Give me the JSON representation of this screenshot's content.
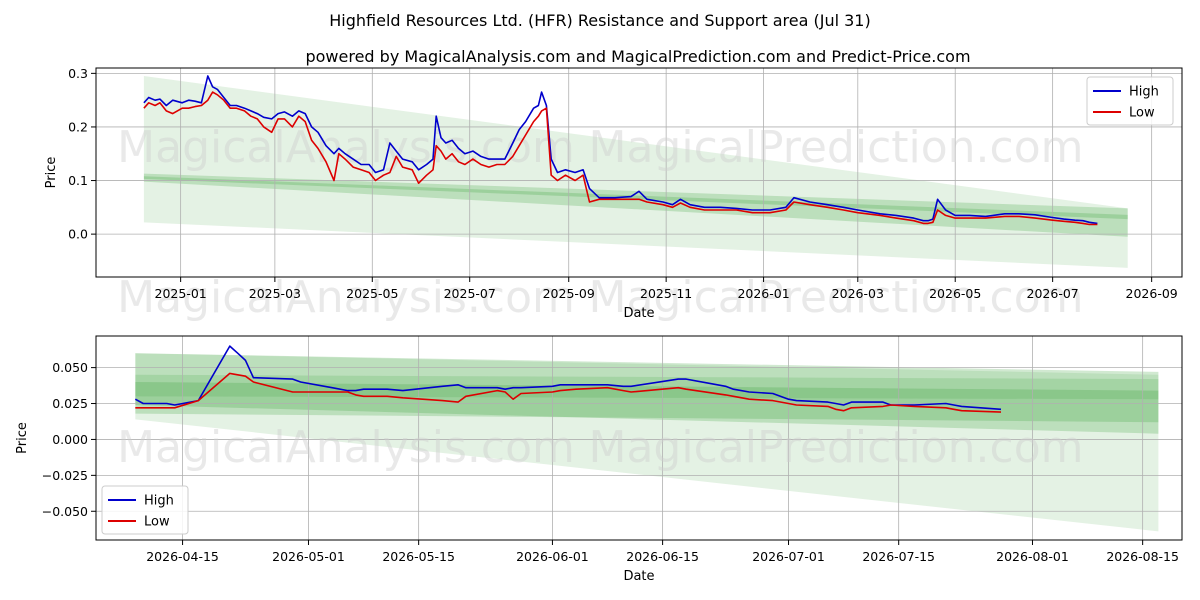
{
  "header": {
    "title": "Highfield Resources Ltd. (HFR) Resistance and Support area (Jul 31)",
    "subtitle": "powered by MagicalAnalysis.com and MagicalPrediction.com and Predict-Price.com"
  },
  "watermarks": [
    "MagicalAnalysis.com",
    "MagicalPrediction.com"
  ],
  "colors": {
    "high": "#0000cc",
    "low": "#dd0000",
    "band": "#2e9a2e"
  },
  "chart_data": [
    {
      "type": "line",
      "xlabel": "Date",
      "ylabel": "Price",
      "xlim": [
        "2024-11-09",
        "2026-09-20"
      ],
      "ylim": [
        -0.08,
        0.31
      ],
      "grid": true,
      "legend_position": "top-right",
      "xticks": [
        "2025-01",
        "2025-03",
        "2025-05",
        "2025-07",
        "2025-09",
        "2025-11",
        "2026-01",
        "2026-03",
        "2026-05",
        "2026-07",
        "2026-09"
      ],
      "xtick_dates": [
        "2025-01-01",
        "2025-03-01",
        "2025-05-01",
        "2025-07-01",
        "2025-09-01",
        "2025-11-01",
        "2026-01-01",
        "2026-03-01",
        "2026-05-01",
        "2026-07-01",
        "2026-09-01"
      ],
      "yticks": [
        "0.0",
        "0.1",
        "0.2",
        "0.3"
      ],
      "ytick_values": [
        0.0,
        0.1,
        0.2,
        0.3
      ],
      "bands": [
        {
          "x": [
            "2024-12-09",
            "2026-08-17"
          ],
          "upper": [
            0.295,
            0.048
          ],
          "lower": [
            0.022,
            -0.063
          ],
          "opacity": 0.13
        },
        {
          "x": [
            "2024-12-09",
            "2026-08-17"
          ],
          "upper": [
            0.113,
            0.048
          ],
          "lower": [
            0.103,
            0.028
          ],
          "opacity": 0.22
        },
        {
          "x": [
            "2024-12-09",
            "2026-08-17"
          ],
          "upper": [
            0.108,
            0.036
          ],
          "lower": [
            0.098,
            -0.005
          ],
          "opacity": 0.22
        }
      ],
      "series": [
        {
          "name": "High",
          "x": [
            "2024-12-09",
            "2024-12-12",
            "2024-12-16",
            "2024-12-19",
            "2024-12-23",
            "2024-12-27",
            "2025-01-02",
            "2025-01-06",
            "2025-01-10",
            "2025-01-14",
            "2025-01-18",
            "2025-01-21",
            "2025-01-24",
            "2025-01-28",
            "2025-02-01",
            "2025-02-05",
            "2025-02-10",
            "2025-02-14",
            "2025-02-18",
            "2025-02-22",
            "2025-02-27",
            "2025-03-03",
            "2025-03-07",
            "2025-03-12",
            "2025-03-16",
            "2025-03-20",
            "2025-03-24",
            "2025-03-28",
            "2025-04-02",
            "2025-04-07",
            "2025-04-10",
            "2025-04-14",
            "2025-04-19",
            "2025-04-24",
            "2025-04-29",
            "2025-05-03",
            "2025-05-08",
            "2025-05-12",
            "2025-05-16",
            "2025-05-20",
            "2025-05-26",
            "2025-05-30",
            "2025-06-04",
            "2025-06-08",
            "2025-06-10",
            "2025-06-13",
            "2025-06-16",
            "2025-06-20",
            "2025-06-24",
            "2025-06-28",
            "2025-07-03",
            "2025-07-08",
            "2025-07-13",
            "2025-07-18",
            "2025-07-23",
            "2025-07-28",
            "2025-08-01",
            "2025-08-05",
            "2025-08-10",
            "2025-08-13",
            "2025-08-15",
            "2025-08-18",
            "2025-08-21",
            "2025-08-25",
            "2025-08-30",
            "2025-09-05",
            "2025-09-10",
            "2025-09-14",
            "2025-09-20",
            "2025-09-30",
            "2025-10-10",
            "2025-10-15",
            "2025-10-20",
            "2025-10-30",
            "2025-11-05",
            "2025-11-10",
            "2025-11-16",
            "2025-11-25",
            "2025-12-05",
            "2025-12-15",
            "2025-12-25",
            "2026-01-05",
            "2026-01-15",
            "2026-01-20",
            "2026-01-30",
            "2026-02-10",
            "2026-02-20",
            "2026-03-01",
            "2026-03-15",
            "2026-03-25",
            "2026-04-05",
            "2026-04-11",
            "2026-04-14",
            "2026-04-17",
            "2026-04-20",
            "2026-04-25",
            "2026-05-01",
            "2026-05-10",
            "2026-05-20",
            "2026-06-01",
            "2026-06-10",
            "2026-06-20",
            "2026-07-01",
            "2026-07-08",
            "2026-07-15",
            "2026-07-20",
            "2026-07-24",
            "2026-07-29"
          ],
          "values": [
            0.245,
            0.255,
            0.25,
            0.252,
            0.24,
            0.25,
            0.245,
            0.25,
            0.248,
            0.245,
            0.295,
            0.275,
            0.27,
            0.255,
            0.24,
            0.24,
            0.235,
            0.23,
            0.225,
            0.218,
            0.215,
            0.225,
            0.228,
            0.22,
            0.23,
            0.225,
            0.2,
            0.19,
            0.165,
            0.15,
            0.16,
            0.15,
            0.14,
            0.13,
            0.13,
            0.115,
            0.12,
            0.17,
            0.155,
            0.14,
            0.135,
            0.12,
            0.13,
            0.14,
            0.22,
            0.18,
            0.17,
            0.175,
            0.16,
            0.15,
            0.155,
            0.145,
            0.14,
            0.14,
            0.14,
            0.17,
            0.195,
            0.21,
            0.235,
            0.24,
            0.265,
            0.24,
            0.14,
            0.115,
            0.12,
            0.115,
            0.12,
            0.085,
            0.068,
            0.068,
            0.07,
            0.08,
            0.065,
            0.06,
            0.055,
            0.065,
            0.055,
            0.05,
            0.05,
            0.048,
            0.045,
            0.045,
            0.05,
            0.068,
            0.06,
            0.055,
            0.05,
            0.045,
            0.038,
            0.035,
            0.03,
            0.025,
            0.025,
            0.028,
            0.065,
            0.045,
            0.035,
            0.035,
            0.033,
            0.038,
            0.038,
            0.036,
            0.031,
            0.028,
            0.026,
            0.025,
            0.022,
            0.02
          ]
        },
        {
          "name": "Low",
          "x": [
            "2024-12-09",
            "2024-12-12",
            "2024-12-16",
            "2024-12-19",
            "2024-12-23",
            "2024-12-27",
            "2025-01-02",
            "2025-01-06",
            "2025-01-10",
            "2025-01-14",
            "2025-01-18",
            "2025-01-21",
            "2025-01-24",
            "2025-01-28",
            "2025-02-01",
            "2025-02-05",
            "2025-02-10",
            "2025-02-14",
            "2025-02-18",
            "2025-02-22",
            "2025-02-27",
            "2025-03-03",
            "2025-03-07",
            "2025-03-12",
            "2025-03-16",
            "2025-03-20",
            "2025-03-24",
            "2025-03-28",
            "2025-04-02",
            "2025-04-07",
            "2025-04-10",
            "2025-04-14",
            "2025-04-19",
            "2025-04-24",
            "2025-04-29",
            "2025-05-03",
            "2025-05-08",
            "2025-05-12",
            "2025-05-16",
            "2025-05-20",
            "2025-05-26",
            "2025-05-30",
            "2025-06-04",
            "2025-06-08",
            "2025-06-10",
            "2025-06-13",
            "2025-06-16",
            "2025-06-20",
            "2025-06-24",
            "2025-06-28",
            "2025-07-03",
            "2025-07-08",
            "2025-07-13",
            "2025-07-18",
            "2025-07-23",
            "2025-07-28",
            "2025-08-01",
            "2025-08-05",
            "2025-08-10",
            "2025-08-13",
            "2025-08-15",
            "2025-08-18",
            "2025-08-21",
            "2025-08-25",
            "2025-08-30",
            "2025-09-05",
            "2025-09-10",
            "2025-09-14",
            "2025-09-20",
            "2025-09-30",
            "2025-10-10",
            "2025-10-15",
            "2025-10-20",
            "2025-10-30",
            "2025-11-05",
            "2025-11-10",
            "2025-11-16",
            "2025-11-25",
            "2025-12-05",
            "2025-12-15",
            "2025-12-25",
            "2026-01-05",
            "2026-01-15",
            "2026-01-20",
            "2026-01-30",
            "2026-02-10",
            "2026-02-20",
            "2026-03-01",
            "2026-03-15",
            "2026-03-25",
            "2026-04-05",
            "2026-04-11",
            "2026-04-14",
            "2026-04-17",
            "2026-04-20",
            "2026-04-25",
            "2026-05-01",
            "2026-05-10",
            "2026-05-20",
            "2026-06-01",
            "2026-06-10",
            "2026-06-20",
            "2026-07-01",
            "2026-07-08",
            "2026-07-15",
            "2026-07-20",
            "2026-07-24",
            "2026-07-29"
          ],
          "values": [
            0.235,
            0.245,
            0.24,
            0.245,
            0.23,
            0.225,
            0.235,
            0.235,
            0.238,
            0.24,
            0.25,
            0.265,
            0.26,
            0.25,
            0.235,
            0.235,
            0.23,
            0.22,
            0.215,
            0.2,
            0.19,
            0.215,
            0.215,
            0.2,
            0.22,
            0.21,
            0.175,
            0.16,
            0.135,
            0.1,
            0.15,
            0.14,
            0.125,
            0.12,
            0.115,
            0.1,
            0.11,
            0.115,
            0.145,
            0.125,
            0.12,
            0.095,
            0.11,
            0.12,
            0.165,
            0.155,
            0.14,
            0.15,
            0.135,
            0.13,
            0.14,
            0.13,
            0.125,
            0.13,
            0.13,
            0.145,
            0.165,
            0.185,
            0.21,
            0.22,
            0.23,
            0.235,
            0.11,
            0.1,
            0.11,
            0.1,
            0.11,
            0.06,
            0.065,
            0.065,
            0.065,
            0.065,
            0.06,
            0.055,
            0.05,
            0.058,
            0.05,
            0.045,
            0.045,
            0.045,
            0.04,
            0.04,
            0.045,
            0.06,
            0.055,
            0.05,
            0.045,
            0.04,
            0.035,
            0.03,
            0.025,
            0.02,
            0.02,
            0.022,
            0.045,
            0.035,
            0.03,
            0.03,
            0.03,
            0.033,
            0.033,
            0.03,
            0.026,
            0.024,
            0.022,
            0.02,
            0.018,
            0.018
          ]
        }
      ]
    },
    {
      "type": "line",
      "xlabel": "Date",
      "ylabel": "Price",
      "xlim": [
        "2026-04-04",
        "2026-08-20"
      ],
      "ylim": [
        -0.07,
        0.072
      ],
      "grid": true,
      "legend_position": "bottom-left",
      "xticks": [
        "2026-04-15",
        "2026-05-01",
        "2026-05-15",
        "2026-06-01",
        "2026-06-15",
        "2026-07-01",
        "2026-07-15",
        "2026-08-01",
        "2026-08-15"
      ],
      "xtick_dates": [
        "2026-04-15",
        "2026-05-01",
        "2026-05-15",
        "2026-06-01",
        "2026-06-15",
        "2026-07-01",
        "2026-07-15",
        "2026-08-01",
        "2026-08-15"
      ],
      "yticks": [
        "0.050",
        "0.025",
        "0.000",
        "−0.025",
        "−0.050"
      ],
      "ytick_values": [
        0.05,
        0.025,
        0.0,
        -0.025,
        -0.05
      ],
      "bands": [
        {
          "x": [
            "2026-04-09",
            "2026-08-17"
          ],
          "upper": [
            0.06,
            0.045
          ],
          "lower": [
            0.014,
            -0.064
          ],
          "opacity": 0.13
        },
        {
          "x": [
            "2026-04-09",
            "2026-08-17"
          ],
          "upper": [
            0.06,
            0.047
          ],
          "lower": [
            0.024,
            0.004
          ],
          "opacity": 0.22
        },
        {
          "x": [
            "2026-04-09",
            "2026-08-17"
          ],
          "upper": [
            0.04,
            0.034
          ],
          "lower": [
            0.018,
            0.012
          ],
          "opacity": 0.22
        },
        {
          "x": [
            "2026-04-09",
            "2026-08-17"
          ],
          "upper": [
            0.045,
            0.042
          ],
          "lower": [
            0.03,
            0.028
          ],
          "opacity": 0.16
        }
      ],
      "series": [
        {
          "name": "High",
          "x": [
            "2026-04-09",
            "2026-04-10",
            "2026-04-13",
            "2026-04-14",
            "2026-04-17",
            "2026-04-21",
            "2026-04-22",
            "2026-04-23",
            "2026-04-24",
            "2026-04-29",
            "2026-04-30",
            "2026-05-04",
            "2026-05-06",
            "2026-05-07",
            "2026-05-08",
            "2026-05-11",
            "2026-05-13",
            "2026-05-18",
            "2026-05-20",
            "2026-05-21",
            "2026-05-25",
            "2026-05-26",
            "2026-05-27",
            "2026-05-28",
            "2026-06-01",
            "2026-06-02",
            "2026-06-04",
            "2026-06-08",
            "2026-06-10",
            "2026-06-11",
            "2026-06-17",
            "2026-06-18",
            "2026-06-23",
            "2026-06-24",
            "2026-06-26",
            "2026-06-29",
            "2026-07-01",
            "2026-07-02",
            "2026-07-06",
            "2026-07-07",
            "2026-07-08",
            "2026-07-09",
            "2026-07-13",
            "2026-07-14",
            "2026-07-17",
            "2026-07-21",
            "2026-07-22",
            "2026-07-23",
            "2026-07-28"
          ],
          "values": [
            0.028,
            0.025,
            0.025,
            0.024,
            0.027,
            0.065,
            0.06,
            0.055,
            0.043,
            0.042,
            0.04,
            0.036,
            0.034,
            0.034,
            0.035,
            0.035,
            0.034,
            0.037,
            0.038,
            0.036,
            0.036,
            0.035,
            0.036,
            0.036,
            0.037,
            0.038,
            0.038,
            0.038,
            0.037,
            0.037,
            0.042,
            0.042,
            0.037,
            0.035,
            0.033,
            0.032,
            0.028,
            0.027,
            0.026,
            0.025,
            0.024,
            0.026,
            0.026,
            0.024,
            0.024,
            0.025,
            0.024,
            0.023,
            0.021
          ]
        },
        {
          "name": "Low",
          "x": [
            "2026-04-09",
            "2026-04-10",
            "2026-04-13",
            "2026-04-14",
            "2026-04-17",
            "2026-04-21",
            "2026-04-22",
            "2026-04-23",
            "2026-04-24",
            "2026-04-29",
            "2026-04-30",
            "2026-05-04",
            "2026-05-06",
            "2026-05-07",
            "2026-05-08",
            "2026-05-11",
            "2026-05-13",
            "2026-05-18",
            "2026-05-20",
            "2026-05-21",
            "2026-05-25",
            "2026-05-26",
            "2026-05-27",
            "2026-05-28",
            "2026-06-01",
            "2026-06-02",
            "2026-06-04",
            "2026-06-08",
            "2026-06-10",
            "2026-06-11",
            "2026-06-17",
            "2026-06-18",
            "2026-06-23",
            "2026-06-24",
            "2026-06-26",
            "2026-06-29",
            "2026-07-01",
            "2026-07-02",
            "2026-07-06",
            "2026-07-07",
            "2026-07-08",
            "2026-07-09",
            "2026-07-13",
            "2026-07-14",
            "2026-07-17",
            "2026-07-21",
            "2026-07-22",
            "2026-07-23",
            "2026-07-28"
          ],
          "values": [
            0.022,
            0.022,
            0.022,
            0.022,
            0.027,
            0.046,
            0.045,
            0.044,
            0.04,
            0.033,
            0.033,
            0.033,
            0.033,
            0.031,
            0.03,
            0.03,
            0.029,
            0.027,
            0.026,
            0.03,
            0.034,
            0.033,
            0.028,
            0.032,
            0.033,
            0.034,
            0.035,
            0.036,
            0.034,
            0.033,
            0.036,
            0.035,
            0.031,
            0.03,
            0.028,
            0.027,
            0.025,
            0.024,
            0.023,
            0.021,
            0.02,
            0.022,
            0.023,
            0.024,
            0.023,
            0.022,
            0.021,
            0.02,
            0.019
          ]
        }
      ]
    }
  ]
}
